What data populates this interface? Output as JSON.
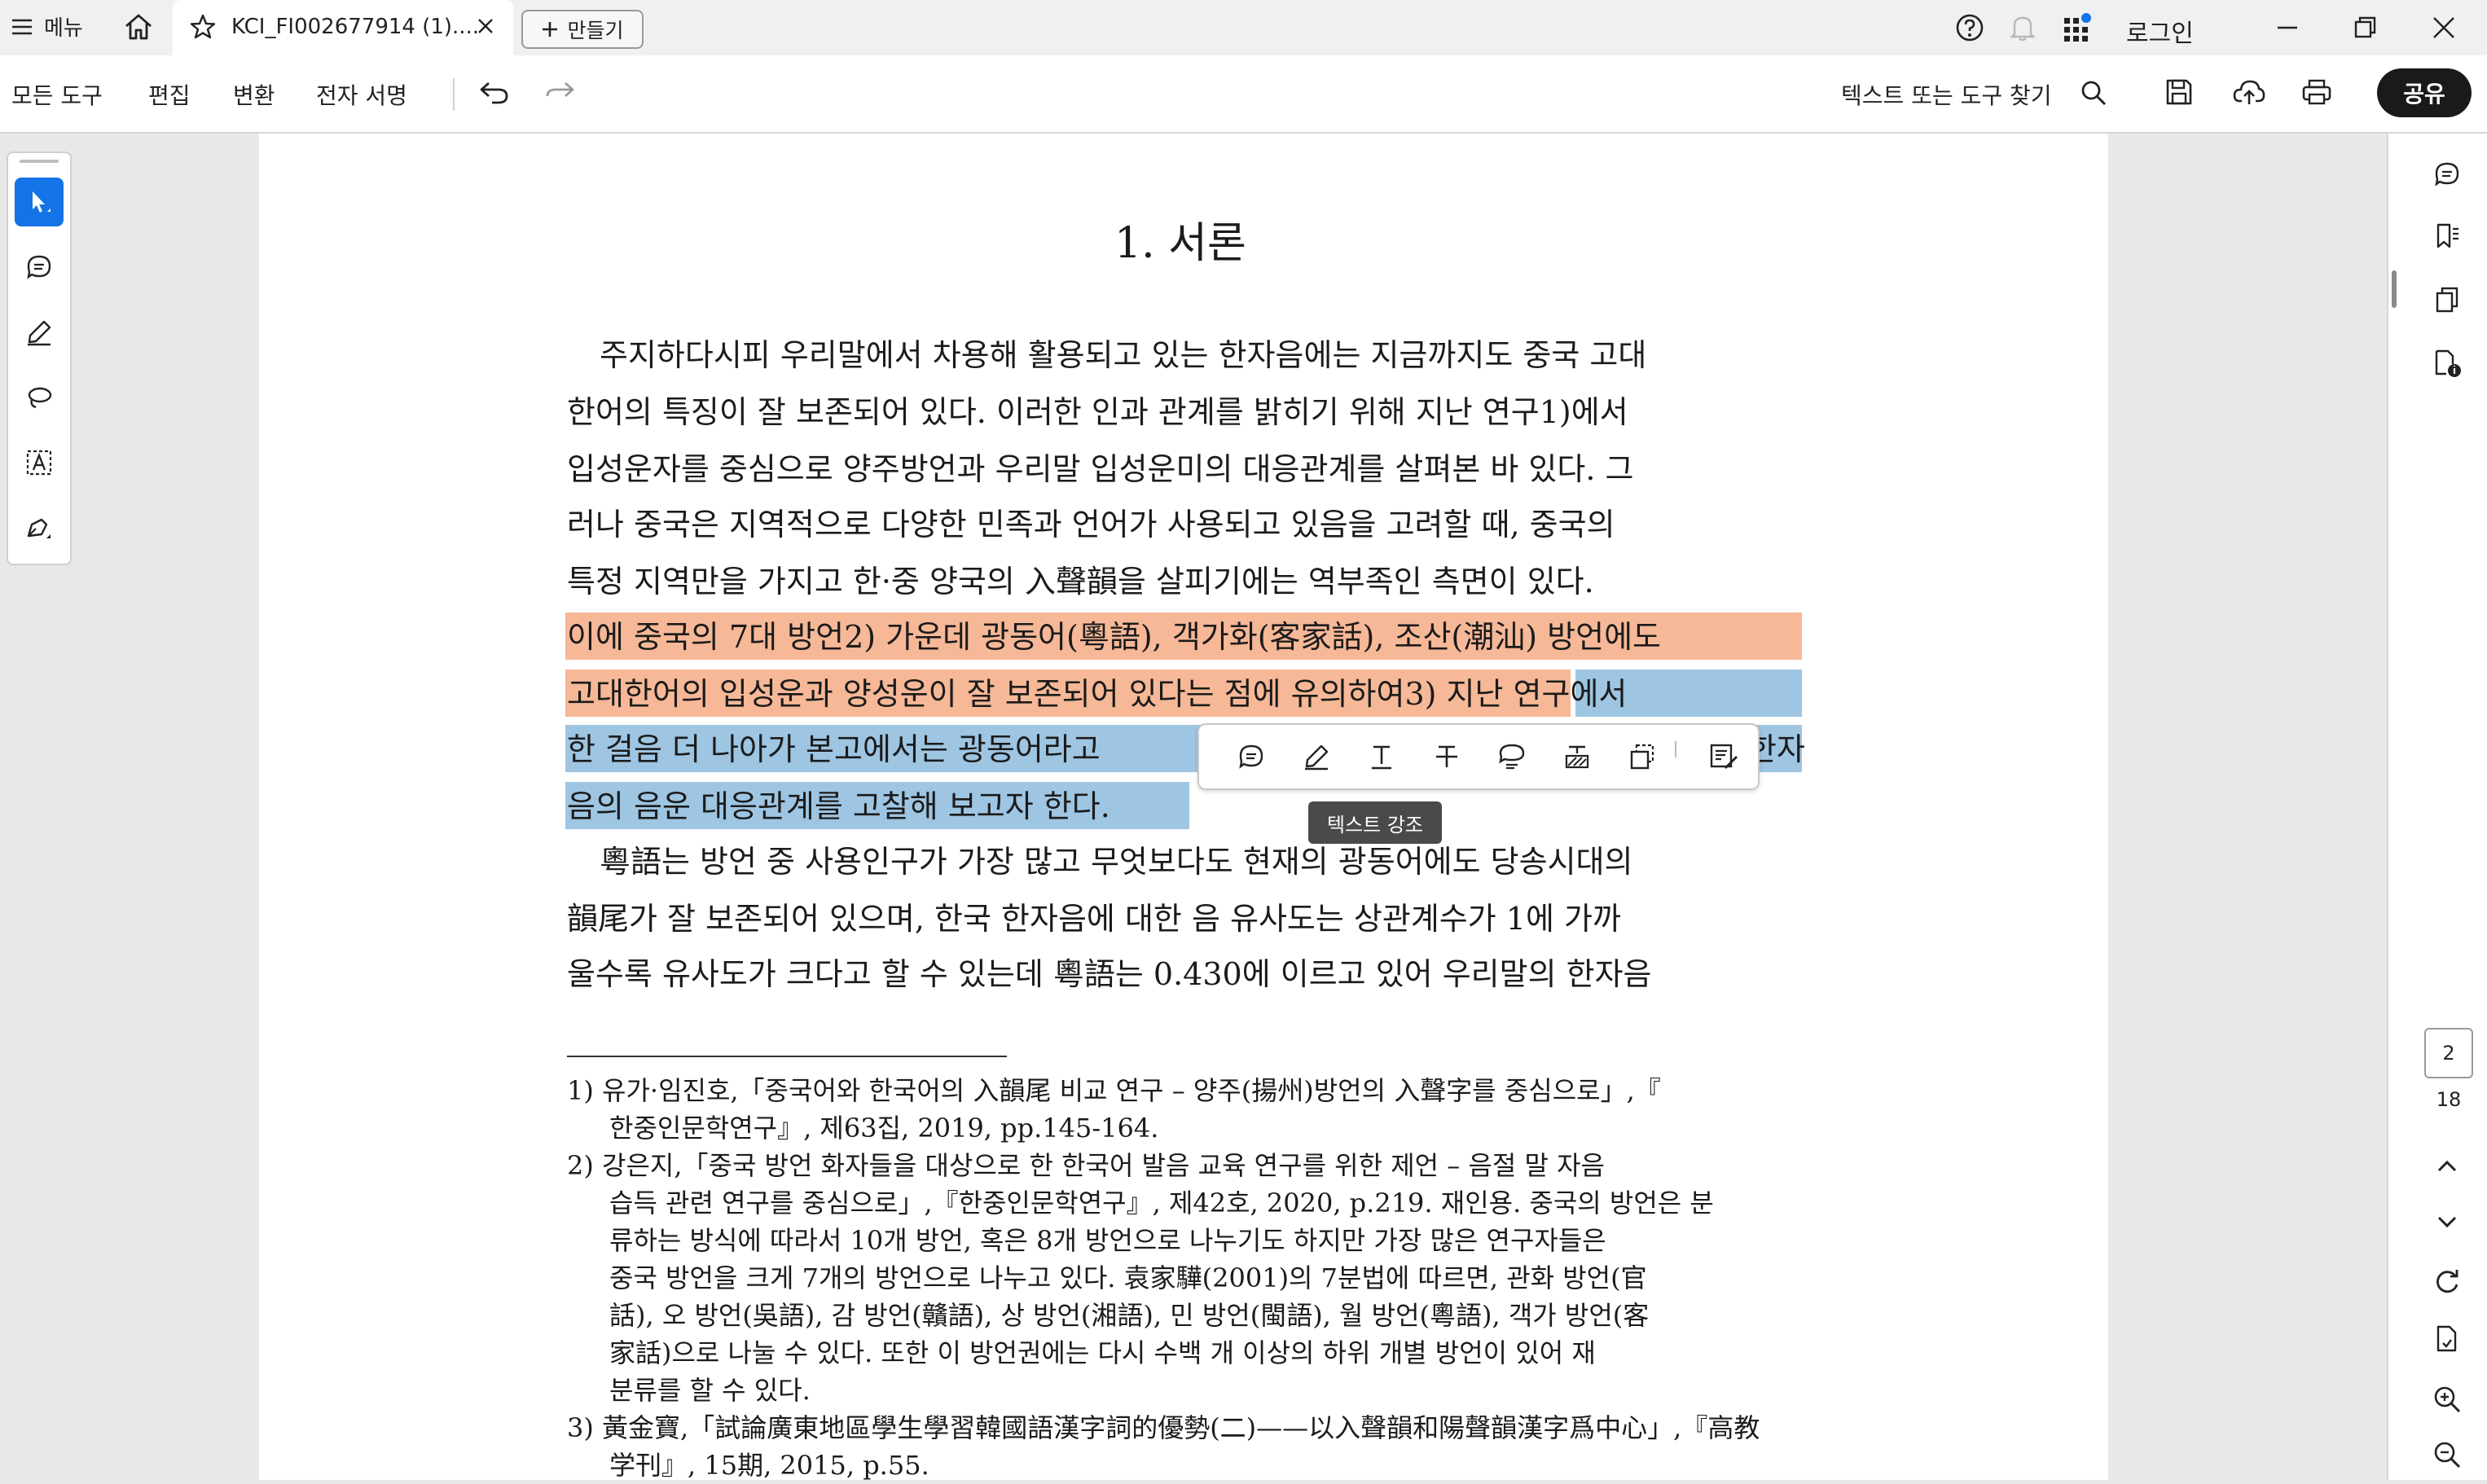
{
  "tabbar": {
    "menu_label": "메뉴",
    "tab_title": "KCI_FI002677914 (1)....",
    "new_tab_label": "만들기",
    "login_label": "로그인"
  },
  "toolbar": {
    "menus": [
      "모든 도구",
      "편집",
      "변환",
      "전자 서명"
    ],
    "search_placeholder": "텍스트 또는 도구 찾기",
    "share_label": "공유"
  },
  "document": {
    "title": "1. 서론",
    "para1": [
      "주지하다시피 우리말에서 차용해 활용되고 있는 한자음에는 지금까지도 중국 고대",
      "한어의 특징이 잘 보존되어 있다. 이러한 인과 관계를 밝히기 위해 지난 연구1)에서",
      "입성운자를 중심으로 양주방언과 우리말 입성운미의 대응관계를 살펴본 바 있다. 그",
      "러나 중국은 지역적으로 다양한 민족과 언어가 사용되고 있음을 고려할 때, 중국의",
      "특정 지역만을 가지고 한·중 양국의 入聲韻을 살피기에는 역부족인 측면이 있다.",
      "이에 중국의 7대 방언2) 가운데 광동어(粵語), 객가화(客家話), 조산(潮汕) 방언에도",
      "고대한어의 입성운과 양성운이 잘 보존되어 있다는 점에 유의하여3) 지난 연구에서",
      "한 걸음 더 나아가 본고에서는 광동어라고",
      "음의 음운 대응관계를 고찰해 보고자 한다."
    ],
    "line8_tail": "한자",
    "para2": [
      "粵語는 방언 중 사용인구가 가장 많고 무엇보다도 현재의 광동어에도 당송시대의",
      "韻尾가 잘 보존되어 있으며, 한국 한자음에 대한 음 유사도는 상관계수가 1에 가까",
      "울수록 유사도가 크다고 할 수 있는데 粵語는 0.430에 이르고 있어 우리말의 한자음"
    ],
    "footnotes": [
      "1) 유가·임진호,「중국어와 한국어의 入韻尾 비교 연구 – 양주(揚州)방언의 入聲字를 중심으로」,『",
      "한중인문학연구』, 제63집, 2019, pp.145-164.",
      "2) 강은지,「중국 방언 화자들을 대상으로 한 한국어 발음 교육 연구를 위한 제언 – 음절 말 자음",
      "습득 관련 연구를 중심으로」,『한중인문학연구』, 제42호, 2020, p.219. 재인용. 중국의 방언은 분",
      "류하는 방식에 따라서 10개 방언, 혹은 8개 방언으로 나누기도 하지만 가장 많은 연구자들은",
      "중국 방언을 크게 7개의 방언으로 나누고 있다. 袁家驊(2001)의 7분법에 따르면, 관화 방언(官",
      "話), 오 방언(吳語), 감 방언(贛語), 상 방언(湘語), 민 방언(閩語), 월 방언(粵語), 객가 방언(客",
      "家話)으로 나눌 수 있다. 또한 이 방언권에는 다시 수백 개 이상의 하위 개별 방언이 있어 재",
      "분류를 할 수 있다.",
      "3) 黃金寶,「試論廣東地區學生學習韓國語漢字詞的優勢(二)——以入聲韻和陽聲韻漢字爲中心」,『高教",
      "学刊』, 15期, 2015, p.55."
    ]
  },
  "popup": {
    "tooltip": "텍스트 강조"
  },
  "pager": {
    "current": "2",
    "total": "18"
  },
  "colors": {
    "highlight_orange": "#f6b897",
    "highlight_blue": "#9ec5e2",
    "accent": "#1473e6",
    "notification_dot": "#1473e6"
  }
}
